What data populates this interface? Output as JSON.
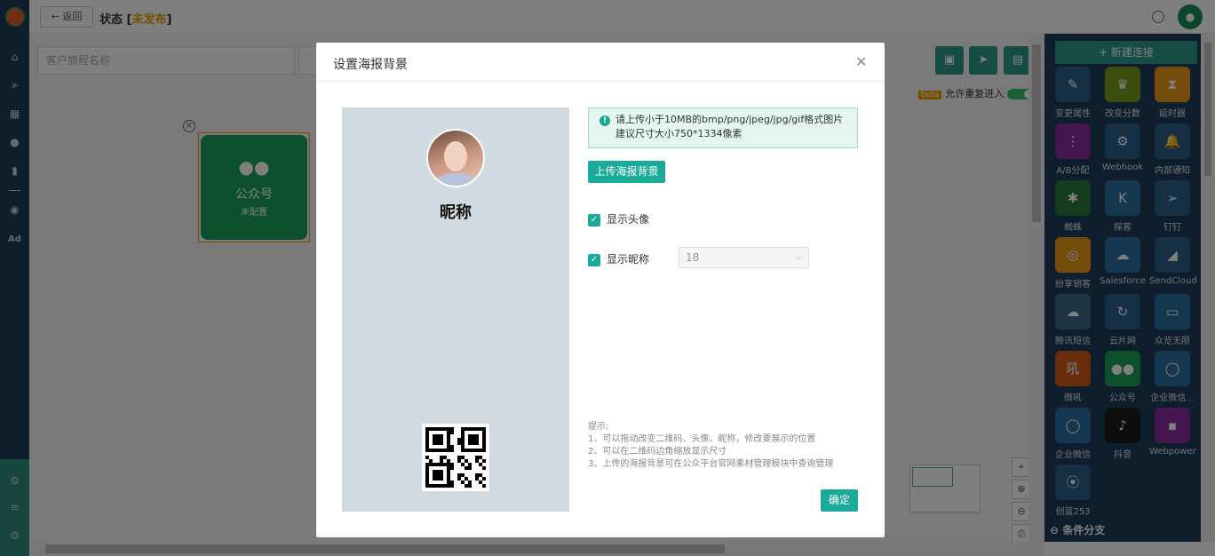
{
  "topbar": {
    "back_label": "← 返回",
    "status_prefix": "状态 [",
    "status_value": "未发布",
    "status_suffix": "]"
  },
  "canvas": {
    "journey_name_placeholder": "客户旅程名称",
    "allow_reentry": {
      "beta": "beta",
      "label": "允许重复进入",
      "enabled": true
    },
    "node": {
      "title": "公众号",
      "subtitle": "未配置"
    }
  },
  "rightpanel": {
    "new_connection": "+ 新建连接",
    "tiles": [
      {
        "label": "变更属性",
        "color": "#2b5f8a",
        "icon": "✎"
      },
      {
        "label": "改变分数",
        "color": "#7b9a1a",
        "icon": "♛"
      },
      {
        "label": "延时器",
        "color": "#e89a1a",
        "icon": "⧗"
      },
      {
        "label": "A/B分配",
        "color": "#8a2aa0",
        "icon": "⋮"
      },
      {
        "label": "Webhook",
        "color": "#2b5f8a",
        "icon": "⚙"
      },
      {
        "label": "内部通知",
        "color": "#2b5f8a",
        "icon": "🔔"
      },
      {
        "label": "蜘蛛",
        "color": "#2a7a3a",
        "icon": "✱"
      },
      {
        "label": "探客",
        "color": "#2b6fa0",
        "icon": "K"
      },
      {
        "label": "钉钉",
        "color": "#2b5f8a",
        "icon": "➢"
      },
      {
        "label": "纷享销客",
        "color": "#e89a1a",
        "icon": "◎"
      },
      {
        "label": "Salesforce",
        "color": "#2b6fa0",
        "icon": "☁"
      },
      {
        "label": "SendCloud",
        "color": "#2b5f8a",
        "icon": "◢"
      },
      {
        "label": "腾讯短信",
        "color": "#3a6a8a",
        "icon": "☁"
      },
      {
        "label": "云片网",
        "color": "#2b5f8a",
        "icon": "↻"
      },
      {
        "label": "众览无限",
        "color": "#2b6fa0",
        "icon": "▭"
      },
      {
        "label": "微吼",
        "color": "#d05a1a",
        "icon": "吼"
      },
      {
        "label": "公众号",
        "color": "#1aa05a",
        "icon": "●●"
      },
      {
        "label": "企业微信...",
        "color": "#2b6fa0",
        "icon": "◯"
      },
      {
        "label": "企业微信",
        "color": "#2b6fa0",
        "icon": "◯"
      },
      {
        "label": "抖音",
        "color": "#1a1a1a",
        "icon": "♪"
      },
      {
        "label": "Webpower",
        "color": "#8a2aa0",
        "icon": "▪"
      },
      {
        "label": "创蓝253",
        "color": "#2b5f8a",
        "icon": "⦿"
      }
    ],
    "condition_branch": "⊖ 条件分支"
  },
  "modal": {
    "title": "设置海报背景",
    "close_icon": "close-icon",
    "preview": {
      "nickname": "昵称"
    },
    "tip": {
      "line1": "请上传小于10MB的bmp/png/jpeg/jpg/gif格式图片",
      "line2": "建议尺寸大小750*1334像素"
    },
    "upload_label": "上传海报背景",
    "show_avatar_label": "显示头像",
    "show_avatar_checked": true,
    "show_nickname_label": "显示昵称",
    "show_nickname_checked": true,
    "font_size_value": "18",
    "hints": {
      "title": "提示:",
      "h1": "1、可以拖动改变二维码、头像、昵称，修改要展示的位置",
      "h2": "2、可以在二维码边角缩放显示尺寸",
      "h3": "3、上传的海报背景可在公众平台官网素材管理模块中查询管理"
    },
    "confirm_label": "确定"
  }
}
